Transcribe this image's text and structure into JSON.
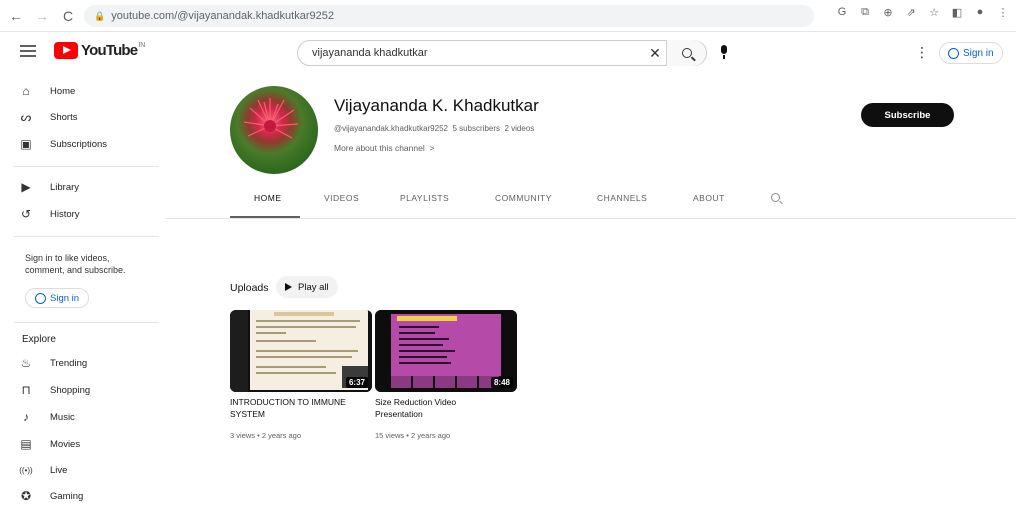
{
  "browser": {
    "url": "youtube.com/@vijayanandak.khadkutkar9252"
  },
  "header": {
    "logo_text": "YouTube",
    "logo_sup": "IN",
    "search_value": "vijayananda khadkutkar",
    "signin_label": "Sign in"
  },
  "sidebar": {
    "items_top": [
      {
        "label": "Home",
        "icon": "home-icon",
        "glyph": "⌂"
      },
      {
        "label": "Shorts",
        "icon": "shorts-icon",
        "glyph": "ᔕ"
      },
      {
        "label": "Subscriptions",
        "icon": "subscriptions-icon",
        "glyph": "▣"
      }
    ],
    "items_mid": [
      {
        "label": "Library",
        "icon": "library-icon",
        "glyph": "▶"
      },
      {
        "label": "History",
        "icon": "history-icon",
        "glyph": "↺"
      }
    ],
    "signin_text": "Sign in to like videos, comment, and subscribe.",
    "signin_label": "Sign in",
    "explore_heading": "Explore",
    "explore_items": [
      {
        "label": "Trending",
        "icon": "trending-icon",
        "glyph": "♨"
      },
      {
        "label": "Shopping",
        "icon": "shopping-icon",
        "glyph": "⊓"
      },
      {
        "label": "Music",
        "icon": "music-icon",
        "glyph": "♪"
      },
      {
        "label": "Movies",
        "icon": "movies-icon",
        "glyph": "▤"
      },
      {
        "label": "Live",
        "icon": "live-icon",
        "glyph": "((•))"
      },
      {
        "label": "Gaming",
        "icon": "gaming-icon",
        "glyph": "✪"
      }
    ]
  },
  "channel": {
    "name": "Vijayananda K. Khadkutkar",
    "handle": "@vijayanandak.khadkutkar9252",
    "subscribers": "5 subscribers",
    "videos_count": "2 videos",
    "more_about": "More about this channel",
    "subscribe_label": "Subscribe"
  },
  "tabs": [
    "HOME",
    "VIDEOS",
    "PLAYLISTS",
    "COMMUNITY",
    "CHANNELS",
    "ABOUT"
  ],
  "uploads": {
    "heading": "Uploads",
    "play_all": "Play all",
    "videos": [
      {
        "title": "INTRODUCTION TO IMMUNE SYSTEM",
        "duration": "6:37",
        "views": "3 views",
        "age": "2 years ago"
      },
      {
        "title": "Size Reduction Video Presentation",
        "duration": "8:48",
        "views": "15 views",
        "age": "2 years ago"
      }
    ]
  }
}
